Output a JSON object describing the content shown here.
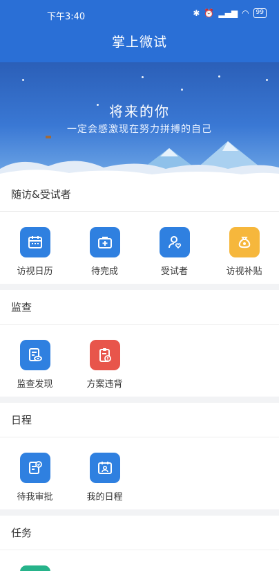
{
  "status_bar": {
    "time": "下午3:40",
    "battery": "99"
  },
  "header": {
    "title": "掌上微试"
  },
  "banner": {
    "title": "将来的你",
    "subtitle": "一定会感激现在努力拼搏的自己"
  },
  "sections": [
    {
      "title": "随访&受试者",
      "items": [
        {
          "label": "访视日历",
          "icon": "calendar-icon",
          "color": "#2f80e0"
        },
        {
          "label": "待完成",
          "icon": "medical-kit-icon",
          "color": "#2f80e0"
        },
        {
          "label": "受试者",
          "icon": "person-heart-icon",
          "color": "#2f80e0"
        },
        {
          "label": "访视补贴",
          "icon": "money-bag-icon",
          "color": "#f6b73c"
        }
      ]
    },
    {
      "title": "监查",
      "items": [
        {
          "label": "监查发现",
          "icon": "document-eye-icon",
          "color": "#2f80e0"
        },
        {
          "label": "方案违背",
          "icon": "clipboard-alert-icon",
          "color": "#e8554b"
        }
      ]
    },
    {
      "title": "日程",
      "items": [
        {
          "label": "待我审批",
          "icon": "approval-check-icon",
          "color": "#2f80e0"
        },
        {
          "label": "我的日程",
          "icon": "calendar-person-icon",
          "color": "#2f80e0"
        }
      ]
    },
    {
      "title": "任务",
      "items": [
        {
          "label": "",
          "icon": "task-icon",
          "color": "#26b38a"
        }
      ]
    }
  ]
}
